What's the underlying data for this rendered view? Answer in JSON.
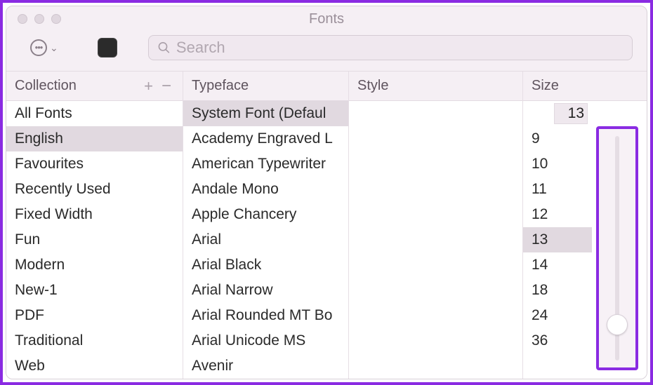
{
  "window": {
    "title": "Fonts"
  },
  "toolbar": {
    "search_placeholder": "Search",
    "search_value": ""
  },
  "columns": {
    "collection": {
      "header": "Collection",
      "items": [
        "All Fonts",
        "English",
        "Favourites",
        "Recently Used",
        "Fixed Width",
        "Fun",
        "Modern",
        "New-1",
        "PDF",
        "Traditional",
        "Web"
      ],
      "selected_index": 1
    },
    "typeface": {
      "header": "Typeface",
      "items": [
        "System Font (Defaul",
        "Academy Engraved L",
        "American Typewriter",
        "Andale Mono",
        "Apple Chancery",
        "Arial",
        "Arial Black",
        "Arial Narrow",
        "Arial Rounded MT Bo",
        "Arial Unicode MS",
        "Avenir"
      ],
      "selected_index": 0
    },
    "style": {
      "header": "Style",
      "items": []
    },
    "size": {
      "header": "Size",
      "current": "13",
      "options": [
        "9",
        "10",
        "11",
        "12",
        "13",
        "14",
        "18",
        "24",
        "36"
      ],
      "selected_index": 4
    }
  }
}
